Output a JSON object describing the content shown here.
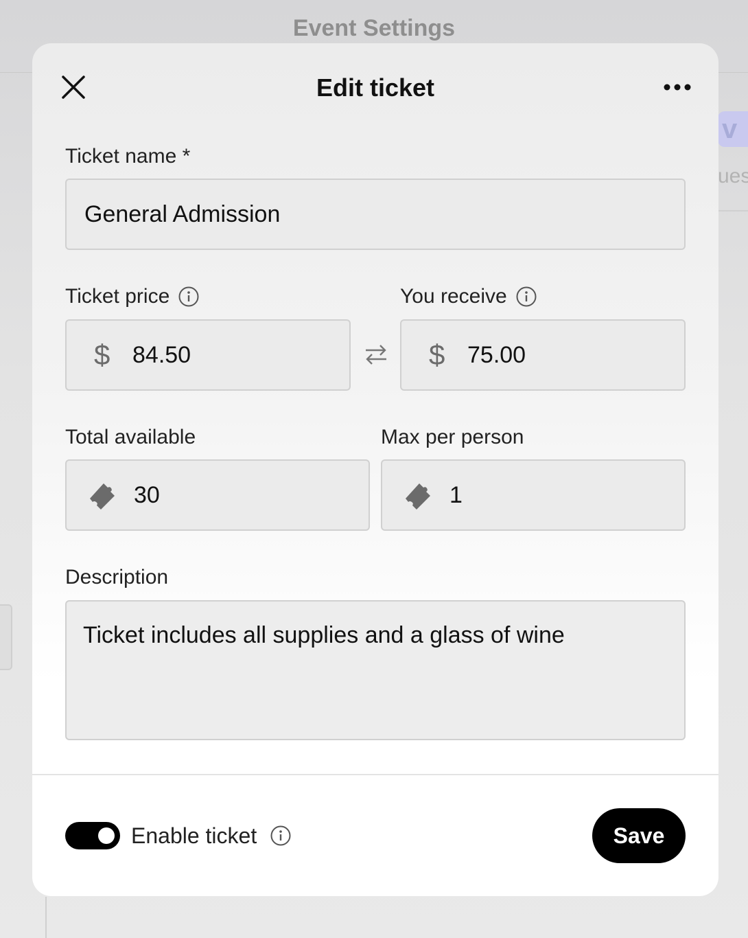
{
  "background": {
    "page_title": "Event Settings",
    "logo_fragment": "v",
    "text_fragment": "ues"
  },
  "modal": {
    "title": "Edit ticket",
    "ticket_name": {
      "label": "Ticket name *",
      "value": "General Admission"
    },
    "ticket_price": {
      "label": "Ticket price",
      "currency_symbol": "$",
      "value": "84.50"
    },
    "you_receive": {
      "label": "You receive",
      "currency_symbol": "$",
      "value": "75.00"
    },
    "total_available": {
      "label": "Total available",
      "value": "30"
    },
    "max_per_person": {
      "label": "Max per person",
      "value": "1"
    },
    "description": {
      "label": "Description",
      "value": "Ticket includes all supplies and a glass of wine"
    },
    "enable_ticket": {
      "label": "Enable ticket",
      "enabled": true
    },
    "save_label": "Save"
  },
  "icons": {
    "close": "close-icon",
    "more": "more-icon",
    "info": "info-icon",
    "swap": "swap-icon",
    "ticket": "ticket-icon"
  },
  "colors": {
    "accent": "#000000",
    "input_bg": "#ebebeb",
    "icon_gray": "#6b6b6b"
  }
}
